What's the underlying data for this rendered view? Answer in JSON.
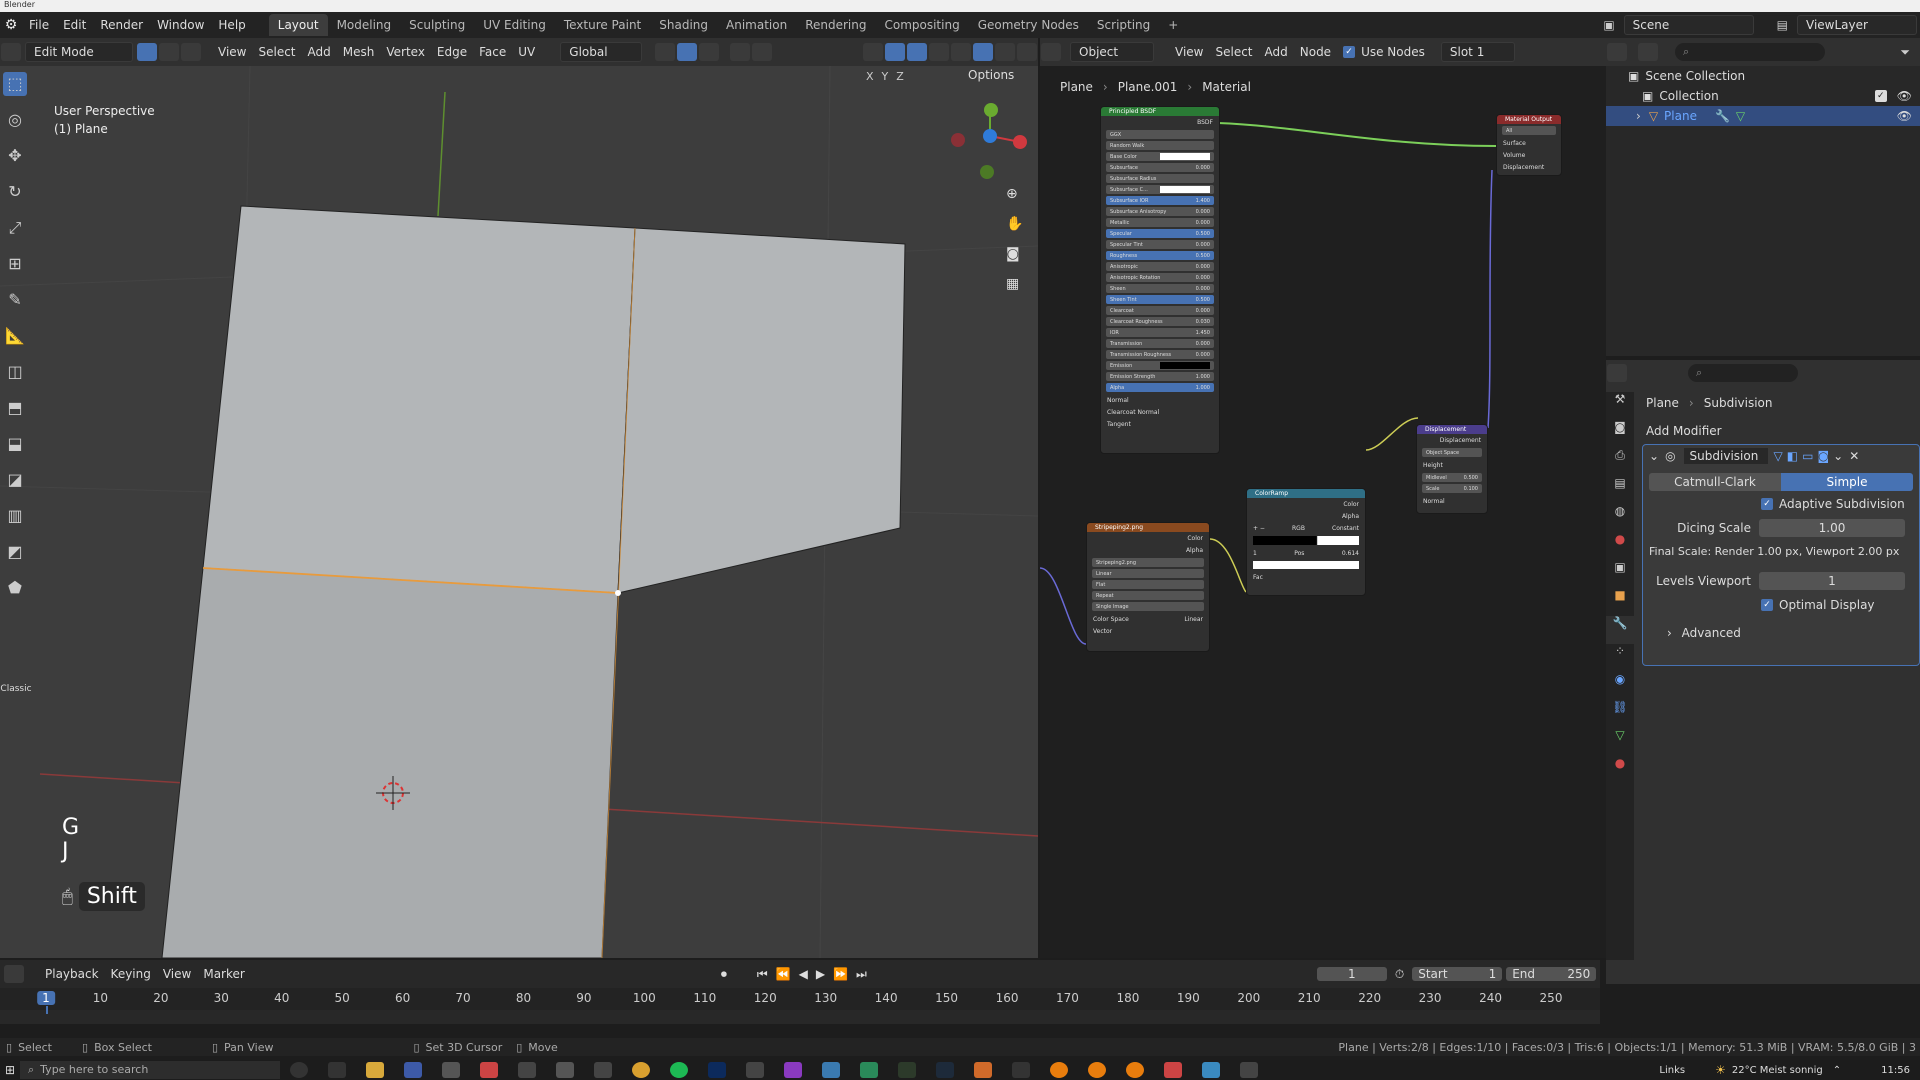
{
  "title_strip": "Blender",
  "menu": [
    "File",
    "Edit",
    "Render",
    "Window",
    "Help"
  ],
  "workspaces": [
    "Layout",
    "Modeling",
    "Sculpting",
    "UV Editing",
    "Texture Paint",
    "Shading",
    "Animation",
    "Rendering",
    "Compositing",
    "Geometry Nodes",
    "Scripting",
    "+"
  ],
  "scene": {
    "label": "Scene",
    "view_layer": "ViewLayer"
  },
  "viewport_header": {
    "mode": "Edit Mode",
    "menus": [
      "View",
      "Select",
      "Add",
      "Mesh",
      "Vertex",
      "Edge",
      "Face",
      "UV"
    ],
    "transform": "Global",
    "options": "Options",
    "axes": [
      "X",
      "Y",
      "Z"
    ]
  },
  "viewport": {
    "perspective": "User Perspective",
    "object": "(1) Plane",
    "keys": [
      "G",
      "J"
    ],
    "modifier_key": "Shift",
    "tool_tab": "Classic",
    "colors": {
      "bg": "#3d3d3d",
      "mesh": "#b3b6b8",
      "edge": "#e89b3d"
    }
  },
  "node_editor_header": {
    "mode": "Object",
    "menus": [
      "View",
      "Select",
      "Add",
      "Node"
    ],
    "use_nodes": "Use Nodes",
    "slot": "Slot 1",
    "breadcrumb": [
      "Plane",
      "Plane.001",
      "Material"
    ]
  },
  "nodes": {
    "bsdf": {
      "title": "Principled BSDF",
      "output": "BSDF",
      "dropdowns": [
        "GGX",
        "Random Walk"
      ],
      "fields": [
        {
          "label": "Base Color",
          "value": ""
        },
        {
          "label": "Subsurface",
          "value": "0.000"
        },
        {
          "label": "Subsurface Radius",
          "value": ""
        },
        {
          "label": "Subsurface C...",
          "value": ""
        },
        {
          "label": "Subsurface IOR",
          "value": "1.400"
        },
        {
          "label": "Subsurface Anisotropy",
          "value": "0.000"
        },
        {
          "label": "Metallic",
          "value": "0.000"
        },
        {
          "label": "Specular",
          "value": "0.500"
        },
        {
          "label": "Specular Tint",
          "value": "0.000"
        },
        {
          "label": "Roughness",
          "value": "0.500"
        },
        {
          "label": "Anisotropic",
          "value": "0.000"
        },
        {
          "label": "Anisotropic Rotation",
          "value": "0.000"
        },
        {
          "label": "Sheen",
          "value": "0.000"
        },
        {
          "label": "Sheen Tint",
          "value": "0.500"
        },
        {
          "label": "Clearcoat",
          "value": "0.000"
        },
        {
          "label": "Clearcoat Roughness",
          "value": "0.030"
        },
        {
          "label": "IOR",
          "value": "1.450"
        },
        {
          "label": "Transmission",
          "value": "0.000"
        },
        {
          "label": "Transmission Roughness",
          "value": "0.000"
        },
        {
          "label": "Emission",
          "value": ""
        },
        {
          "label": "Emission Strength",
          "value": "1.000"
        },
        {
          "label": "Alpha",
          "value": "1.000"
        }
      ],
      "sockets": [
        "Normal",
        "Clearcoat Normal",
        "Tangent"
      ]
    },
    "output": {
      "title": "Material Output",
      "dropdown": "All",
      "sockets": [
        "Surface",
        "Volume",
        "Displacement"
      ]
    },
    "displacement": {
      "title": "Displacement",
      "output": "Displacement",
      "space": "Object Space",
      "inputs": [
        "Height",
        "Midlevel",
        "Scale",
        "Normal"
      ],
      "midlevel": "0.500",
      "scale": "0.100"
    },
    "colorramp": {
      "title": "ColorRamp",
      "outputs": [
        "Color",
        "Alpha"
      ],
      "mode": "RGB",
      "interp": "Constant",
      "pos_index": "1",
      "pos_label": "Pos",
      "pos_value": "0.614",
      "input": "Fac"
    },
    "image": {
      "title": "Stripeping2.png",
      "outputs": [
        "Color",
        "Alpha"
      ],
      "file": "Stripeping2.png",
      "options": [
        "Linear",
        "Flat",
        "Repeat",
        "Single Image"
      ],
      "color_space_label": "Color Space",
      "color_space": "Linear",
      "input": "Vector"
    }
  },
  "outliner": {
    "root": "Scene Collection",
    "collection": "Collection",
    "object": "Plane"
  },
  "properties": {
    "breadcrumb": [
      "Plane",
      "Subdivision"
    ],
    "add_modifier": "Add Modifier",
    "modifier_name": "Subdivision",
    "types": [
      "Catmull-Clark",
      "Simple"
    ],
    "adaptive": "Adaptive Subdivision",
    "dicing_label": "Dicing Scale",
    "dicing_value": "1.00",
    "final_scale": "Final Scale: Render 1.00 px, Viewport 2.00 px",
    "levels_label": "Levels Viewport",
    "levels_value": "1",
    "optimal": "Optimal Display",
    "advanced": "Advanced"
  },
  "timeline": {
    "menus": [
      "Playback",
      "Keying",
      "View",
      "Marker"
    ],
    "current_frame": "1",
    "start_label": "Start",
    "start": "1",
    "end_label": "End",
    "end": "250",
    "ticks": [
      "1",
      "10",
      "20",
      "30",
      "40",
      "50",
      "60",
      "70",
      "80",
      "90",
      "100",
      "110",
      "120",
      "130",
      "140",
      "150",
      "160",
      "170",
      "180",
      "190",
      "200",
      "210",
      "220",
      "230",
      "240",
      "250"
    ]
  },
  "status": {
    "select": "Select",
    "box_select": "Box Select",
    "pan_view": "Pan View",
    "set_cursor": "Set 3D Cursor",
    "move": "Move",
    "stats": "Plane | Verts:2/8 | Edges:1/10 | Faces:0/3 | Tris:6 | Objects:1/1 | Memory: 51.3 MiB | VRAM: 5.5/8.0 GiB | 3"
  },
  "taskbar": {
    "search": "Type here to search",
    "links": "Links",
    "weather": "22°C  Meist sonnig",
    "time": "11:56"
  }
}
